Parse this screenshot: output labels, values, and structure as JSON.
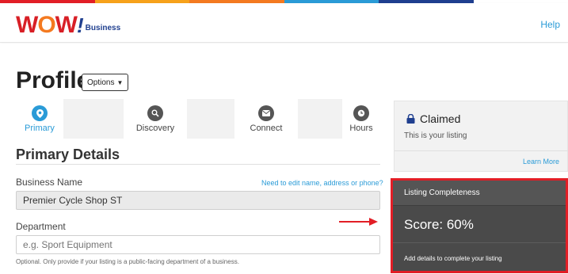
{
  "colors": {
    "accent_blue": "#2a9bd7",
    "brand_red": "#d81f26",
    "brand_orange": "#f47a20",
    "brand_navy": "#1f3f8f",
    "highlight_red": "#e21e26",
    "stripe": [
      "#e21e26",
      "#f7a21b",
      "#f47a20",
      "#2a9bd7",
      "#1f3f8f",
      "#ffffff"
    ]
  },
  "header": {
    "logo": {
      "wow": "WOW!",
      "sub": "Business"
    },
    "help_link": "Help"
  },
  "page": {
    "title": "Profile",
    "options_label": "Options"
  },
  "steps": [
    {
      "label": "Primary",
      "icon": "map-pin-icon",
      "active": true
    },
    {
      "label": "Discovery",
      "icon": "search-icon",
      "active": false
    },
    {
      "label": "Connect",
      "icon": "envelope-icon",
      "active": false
    },
    {
      "label": "Hours",
      "icon": "clock-icon",
      "active": false
    }
  ],
  "primary_details": {
    "title": "Primary Details",
    "business_name": {
      "label": "Business Name",
      "edit_link": "Need to edit name, address or phone?",
      "value": "Premier Cycle Shop ST"
    },
    "department": {
      "label": "Department",
      "placeholder": "e.g. Sport Equipment",
      "help": "Optional. Only provide if your listing is a public-facing department of a business."
    }
  },
  "claimed": {
    "title": "Claimed",
    "subtitle": "This is your listing",
    "learn_more": "Learn More",
    "icon": "lock-icon"
  },
  "completeness": {
    "title": "Listing Completeness",
    "score_label": "Score: 60%",
    "score": 60,
    "footer": "Add details to complete your listing"
  },
  "annotation": {
    "arrow": "red-arrow-icon"
  }
}
